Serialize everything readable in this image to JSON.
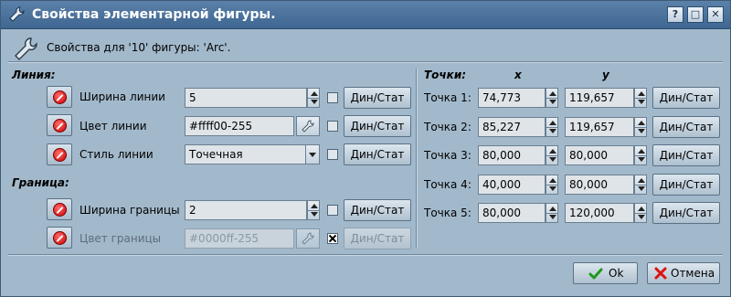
{
  "window": {
    "title": "Свойства элементарной фигуры.",
    "controls": {
      "help": "?",
      "maximize": "□",
      "close": "✕"
    }
  },
  "header": {
    "text": "Свойства для '10' фигуры: 'Arc'."
  },
  "line": {
    "title": "Линия:",
    "width": {
      "label": "Ширина линии",
      "value": "5",
      "button": "Дин/Стат"
    },
    "color": {
      "label": "Цвет линии",
      "value": "#ffff00-255",
      "button": "Дин/Стат"
    },
    "style": {
      "label": "Стиль линии",
      "value": "Точечная",
      "button": "Дин/Стат"
    }
  },
  "border": {
    "title": "Граница:",
    "width": {
      "label": "Ширина границы",
      "value": "2",
      "button": "Дин/Стат"
    },
    "color": {
      "label": "Цвет границы",
      "value": "#0000ff-255",
      "button": "Дин/Стат"
    }
  },
  "points": {
    "title": "Точки:",
    "x_header": "x",
    "y_header": "y",
    "rows": [
      {
        "label": "Точка 1:",
        "x": "74,773",
        "y": "119,657",
        "button": "Дин/Стат"
      },
      {
        "label": "Точка 2:",
        "x": "85,227",
        "y": "119,657",
        "button": "Дин/Стат"
      },
      {
        "label": "Точка 3:",
        "x": "80,000",
        "y": "80,000",
        "button": "Дин/Стат"
      },
      {
        "label": "Точка 4:",
        "x": "40,000",
        "y": "80,000",
        "button": "Дин/Стат"
      },
      {
        "label": "Точка 5:",
        "x": "80,000",
        "y": "120,000",
        "button": "Дин/Стат"
      }
    ]
  },
  "footer": {
    "ok": "Ok",
    "cancel": "Отмена"
  }
}
